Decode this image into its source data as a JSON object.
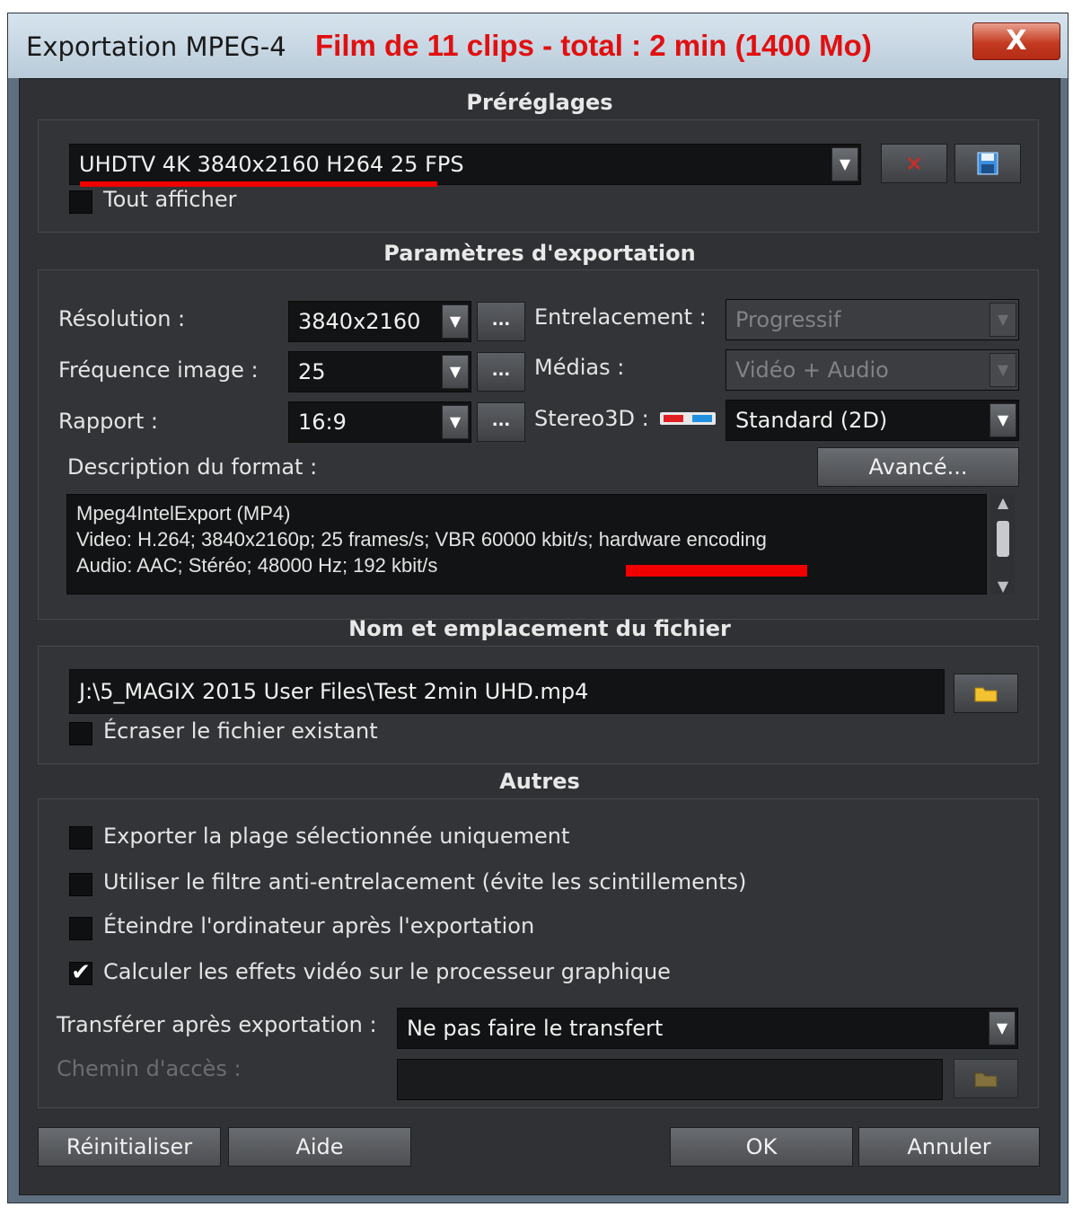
{
  "window": {
    "title": "Exportation MPEG-4",
    "annotation": "Film de 11 clips - total : 2 min (1400 Mo)",
    "close_label": "X"
  },
  "presets": {
    "section_title": "Préréglages",
    "selected": "UHDTV 4K 3840x2160 H264 25 FPS",
    "show_all_label": "Tout afficher",
    "show_all_checked": false
  },
  "export_params": {
    "section_title": "Paramètres d'exportation",
    "resolution_label": "Résolution :",
    "resolution_value": "3840x2160",
    "framerate_label": "Fréquence image :",
    "framerate_value": "25",
    "ratio_label": "Rapport :",
    "ratio_value": "16:9",
    "dots_label": "...",
    "interlace_label": "Entrelacement :",
    "interlace_value": "Progressif",
    "media_label": "Médias :",
    "media_value": "Vidéo + Audio",
    "stereo_label": "Stereo3D :",
    "stereo_value": "Standard (2D)",
    "format_desc_label": "Description du format :",
    "advanced_label": "Avancé...",
    "desc_line1": "Mpeg4IntelExport (MP4)",
    "desc_line2": "Video: H.264; 3840x2160p; 25 frames/s; VBR 60000 kbit/s; hardware encoding",
    "desc_line3": "Audio: AAC; Stéréo; 48000 Hz; 192 kbit/s"
  },
  "file": {
    "section_title": "Nom et emplacement du fichier",
    "path": "J:\\5_MAGIX 2015 User Files\\Test 2min UHD.mp4",
    "overwrite_label": "Écraser le fichier existant",
    "overwrite_checked": false
  },
  "others": {
    "section_title": "Autres",
    "options": [
      {
        "label": "Exporter la plage sélectionnée uniquement",
        "checked": false
      },
      {
        "label": "Utiliser le filtre anti-entrelacement (évite les scintillements)",
        "checked": false
      },
      {
        "label": "Éteindre l'ordinateur après l'exportation",
        "checked": false
      },
      {
        "label": "Calculer les effets vidéo sur le processeur graphique",
        "checked": true
      }
    ],
    "transfer_label": "Transférer après exportation :",
    "transfer_value": "Ne pas faire le transfert",
    "path_label": "Chemin d'accès :",
    "path_value": ""
  },
  "footer": {
    "reset_label": "Réinitialiser",
    "help_label": "Aide",
    "ok_label": "OK",
    "cancel_label": "Annuler"
  },
  "colors": {
    "annotation_red": "#e01010",
    "panel_bg": "#2f3134"
  },
  "icons": {
    "arrow": "▼",
    "check": "✔"
  }
}
